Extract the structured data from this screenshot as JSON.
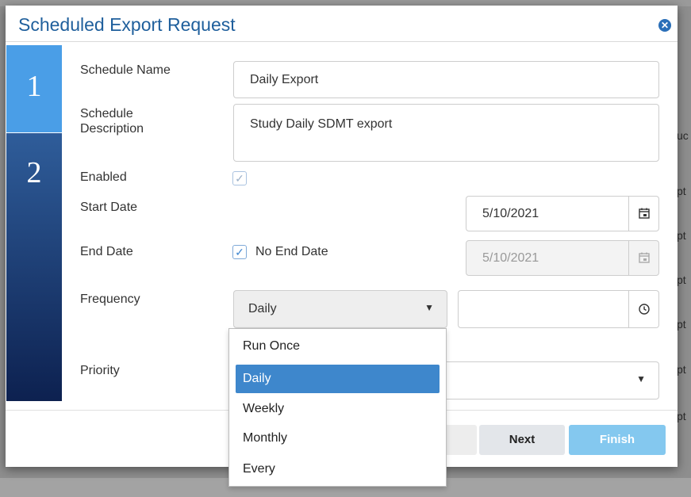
{
  "background": {
    "fragments": [
      "uc",
      "pt",
      "pt",
      "pt",
      "pt",
      "pt",
      "pt"
    ]
  },
  "modal": {
    "title": "Scheduled Export Request",
    "close_icon": "close-circle-icon",
    "steps": [
      "1",
      "2"
    ],
    "fields": {
      "schedule_name_label": "Schedule Name",
      "schedule_name_value": "Daily Export",
      "schedule_description_label": "Schedule Description",
      "schedule_description_value": "Study Daily SDMT export",
      "enabled_label": "Enabled",
      "enabled_checked": true,
      "start_date_label": "Start Date",
      "start_date_value": "5/10/2021",
      "end_date_label": "End Date",
      "no_end_date_label": "No End Date",
      "no_end_date_checked": true,
      "end_date_value": "5/10/2021",
      "frequency_label": "Frequency",
      "frequency_value": "Daily",
      "time_value": "",
      "priority_label": "Priority",
      "priority_value": ""
    },
    "frequency_options": [
      "Run Once",
      "Daily",
      "Weekly",
      "Monthly",
      "Every"
    ],
    "frequency_selected": "Daily",
    "buttons": {
      "next": "Next",
      "finish": "Finish"
    },
    "colors": {
      "title": "#1f5f9c",
      "step_active": "#4a9ee7",
      "step_inactive": "#0d2150",
      "selected_option": "#3e87cc",
      "finish_button": "#84c8ef"
    }
  }
}
